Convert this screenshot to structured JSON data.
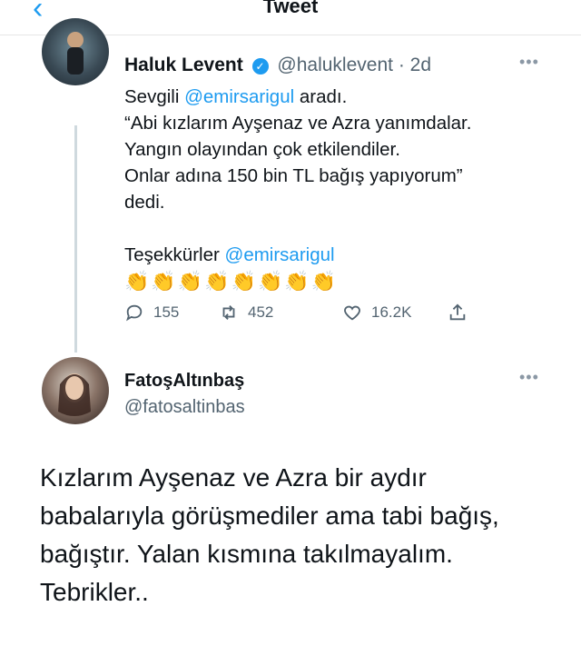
{
  "header": {
    "title": "Tweet",
    "back_icon": "chevron-left-icon"
  },
  "tweet": {
    "author_name": "Haluk Levent",
    "author_handle": "@haluklevent",
    "time": "· 2d",
    "verified": true,
    "line1_pre": "Sevgili ",
    "line1_mention": "@emirsarigul",
    "line1_post": " aradı.",
    "line2": "“Abi kızlarım Ayşenaz ve Azra yanımdalar.",
    "line3": "Yangın olayından çok etkilendiler.",
    "line4": "Onlar adına 150 bin TL bağış yapıyorum”",
    "line5": "dedi.",
    "thanks_pre": "Teşekkürler ",
    "thanks_mention": "@emirsarigul",
    "claps": "👏👏👏👏👏👏👏👏",
    "replies": "155",
    "retweets": "452",
    "likes": "16.2K"
  },
  "reply": {
    "author_name": "FatoşAltınbaş",
    "author_handle": "@fatosaltinbas",
    "text": "Kızlarım Ayşenaz ve Azra bir aydır babalarıyla görüşmediler ama tabi bağış, bağıştır. Yalan kısmına takılmayalım. Tebrikler.."
  },
  "colors": {
    "accent": "#1d9bf0",
    "muted": "#536471"
  }
}
